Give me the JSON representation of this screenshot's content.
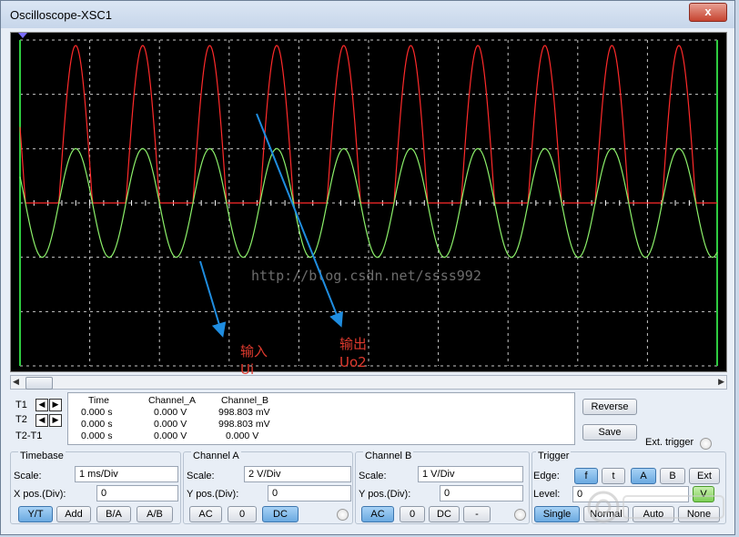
{
  "window": {
    "title": "Oscilloscope-XSC1",
    "close_glyph": "x"
  },
  "cursors": {
    "t1": "T1",
    "t2": "T2",
    "t2t1": "T2-T1"
  },
  "readout": {
    "headers": [
      "Time",
      "Channel_A",
      "Channel_B"
    ],
    "rows": [
      [
        "0.000 s",
        "0.000 V",
        "998.803 mV"
      ],
      [
        "0.000 s",
        "0.000 V",
        "998.803 mV"
      ],
      [
        "0.000 s",
        "0.000 V",
        "0.000 V"
      ]
    ]
  },
  "side_buttons": {
    "reverse": "Reverse",
    "save": "Save",
    "ext_trigger": "Ext. trigger"
  },
  "timebase": {
    "label": "Timebase",
    "scale_label": "Scale:",
    "scale_value": "1 ms/Div",
    "xpos_label": "X pos.(Div):",
    "xpos_value": "0",
    "buttons": [
      "Y/T",
      "Add",
      "B/A",
      "A/B"
    ]
  },
  "channel_a": {
    "label": "Channel A",
    "scale_label": "Scale:",
    "scale_value": "2  V/Div",
    "ypos_label": "Y pos.(Div):",
    "ypos_value": "0",
    "buttons": [
      "AC",
      "0",
      "DC"
    ]
  },
  "channel_b": {
    "label": "Channel B",
    "scale_label": "Scale:",
    "scale_value": "1  V/Div",
    "ypos_label": "Y pos.(Div):",
    "ypos_value": "0",
    "buttons": [
      "AC",
      "0",
      "DC",
      "-"
    ]
  },
  "trigger": {
    "label": "Trigger",
    "edge_label": "Edge:",
    "edge_buttons": [
      "f",
      "t",
      "A",
      "B",
      "Ext"
    ],
    "level_label": "Level:",
    "level_value": "0",
    "level_unit": "V",
    "mode_buttons": [
      "Single",
      "Normal",
      "Auto",
      "None"
    ]
  },
  "annotations": {
    "input_label": "输入",
    "input_sub": "Ui",
    "output_label": "输出",
    "output_sub": "Uo2",
    "watermark": "http://blog.csdn.net/ssss992"
  },
  "colors": {
    "channel_a": "#ff2a2a",
    "channel_b": "#8cf06a",
    "grid": "#c8c8c8",
    "arrow": "#1f8de0",
    "annotation": "#e03a2e"
  },
  "waveform": {
    "channel_a_peak_div": 2.9,
    "channel_b_peak_div": 1.0,
    "cycles": 10
  }
}
